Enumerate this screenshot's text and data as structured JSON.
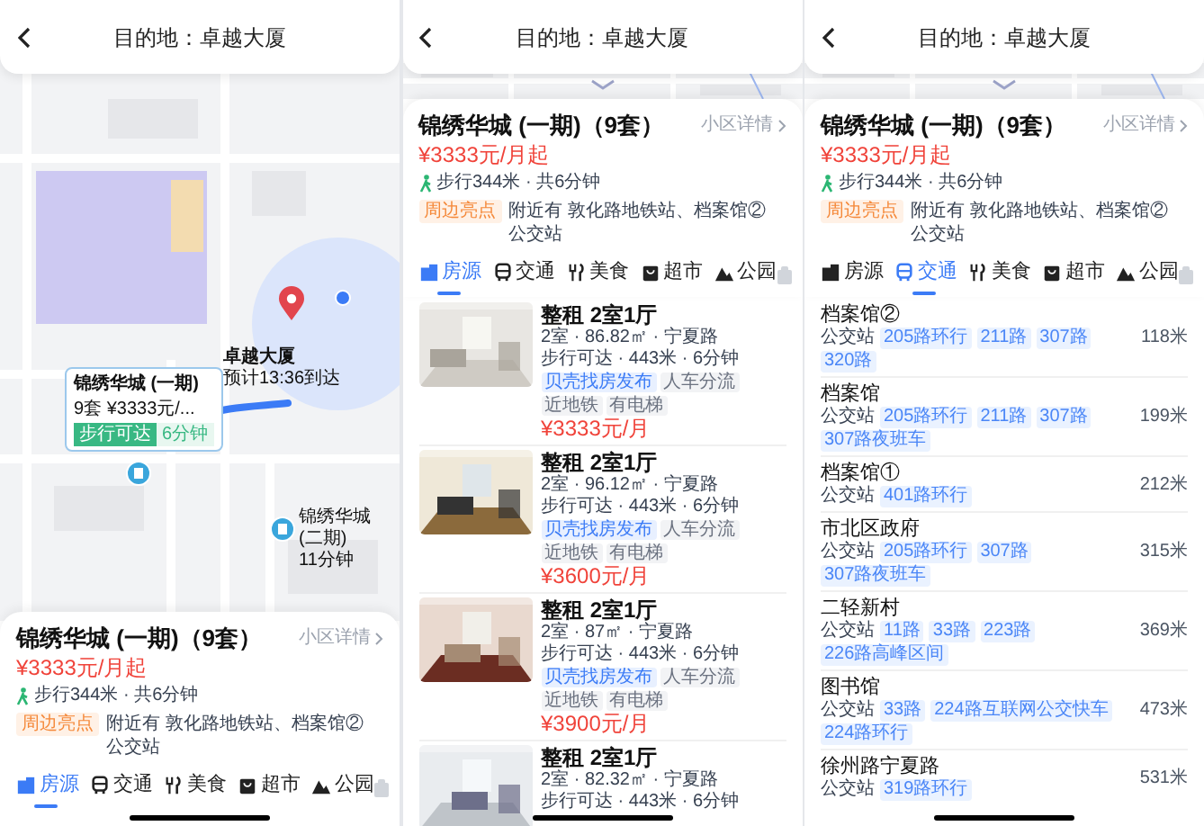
{
  "screens": [
    {
      "kind": "map",
      "header": {
        "title": "目的地：卓越大厦"
      },
      "map": {
        "destination": {
          "name": "卓越大厦",
          "eta": "预计13:36到达"
        },
        "callout": {
          "name": "锦绣华城 (一期)",
          "summary": "9套 ¥3333元/...",
          "tag": "步行可达",
          "time": "6分钟"
        },
        "nearby": {
          "name": "锦绣华城 (二期)",
          "time": "11分钟"
        }
      },
      "sheet": {
        "title": "锦绣华城 (一期)（9套）",
        "detail_link": "小区详情",
        "price": "¥3333元/月起",
        "walk": "步行344米 · 共6分钟",
        "highlight_tag": "周边亮点",
        "highlight": "附近有 敦化路地铁站、档案馆② 公交站",
        "tabs": [
          {
            "label": "房源",
            "selected": true
          },
          {
            "label": "交通",
            "selected": false
          },
          {
            "label": "美食",
            "selected": false
          },
          {
            "label": "超市",
            "selected": false
          },
          {
            "label": "公园",
            "selected": false
          }
        ]
      }
    },
    {
      "kind": "listings",
      "header": {
        "title": "目的地：卓越大厦"
      },
      "sheet": {
        "title": "锦绣华城 (一期)（9套）",
        "detail_link": "小区详情",
        "price": "¥3333元/月起",
        "walk": "步行344米 · 共6分钟",
        "highlight_tag": "周边亮点",
        "highlight": "附近有 敦化路地铁站、档案馆② 公交站",
        "tabs": [
          {
            "label": "房源",
            "selected": true
          },
          {
            "label": "交通",
            "selected": false
          },
          {
            "label": "美食",
            "selected": false
          },
          {
            "label": "超市",
            "selected": false
          },
          {
            "label": "公园",
            "selected": false
          }
        ]
      },
      "listings": [
        {
          "title": "整租 2室1厅",
          "details": "2室 · 86.82㎡ · 宁夏路",
          "walk": "步行可达 · 443米 · 6分钟",
          "tags": [
            {
              "label": "贝壳找房发布",
              "kind": "source"
            },
            {
              "label": "人车分流",
              "kind": "feature"
            },
            {
              "label": "近地铁",
              "kind": "feature"
            },
            {
              "label": "有电梯",
              "kind": "feature"
            }
          ],
          "price": "¥3333元/月"
        },
        {
          "title": "整租 2室1厅",
          "details": "2室 · 96.12㎡ · 宁夏路",
          "walk": "步行可达 · 443米 · 6分钟",
          "tags": [
            {
              "label": "贝壳找房发布",
              "kind": "source"
            },
            {
              "label": "人车分流",
              "kind": "feature"
            },
            {
              "label": "近地铁",
              "kind": "feature"
            },
            {
              "label": "有电梯",
              "kind": "feature"
            }
          ],
          "price": "¥3600元/月"
        },
        {
          "title": "整租 2室1厅",
          "details": "2室 · 87㎡ · 宁夏路",
          "walk": "步行可达 · 443米 · 6分钟",
          "tags": [
            {
              "label": "贝壳找房发布",
              "kind": "source"
            },
            {
              "label": "人车分流",
              "kind": "feature"
            },
            {
              "label": "近地铁",
              "kind": "feature"
            },
            {
              "label": "有电梯",
              "kind": "feature"
            }
          ],
          "price": "¥3900元/月"
        },
        {
          "title": "整租 2室1厅",
          "details": "2室 · 82.32㎡ · 宁夏路",
          "walk": "步行可达 · 443米 · 6分钟"
        }
      ]
    },
    {
      "kind": "transit",
      "header": {
        "title": "目的地：卓越大厦"
      },
      "sheet": {
        "title": "锦绣华城 (一期)（9套）",
        "detail_link": "小区详情",
        "price": "¥3333元/月起",
        "walk": "步行344米 · 共6分钟",
        "highlight_tag": "周边亮点",
        "highlight": "附近有 敦化路地铁站、档案馆② 公交站",
        "tabs": [
          {
            "label": "房源",
            "selected": false
          },
          {
            "label": "交通",
            "selected": true
          },
          {
            "label": "美食",
            "selected": false
          },
          {
            "label": "超市",
            "selected": false
          },
          {
            "label": "公园",
            "selected": false
          }
        ]
      },
      "stations": [
        {
          "name": "档案馆②",
          "type": "公交站",
          "routes": [
            "205路环行",
            "211路",
            "307路",
            "320路"
          ],
          "distance": "118米"
        },
        {
          "name": "档案馆",
          "type": "公交站",
          "routes": [
            "205路环行",
            "211路",
            "307路",
            "307路夜班车"
          ],
          "distance": "199米"
        },
        {
          "name": "档案馆①",
          "type": "公交站",
          "routes": [
            "401路环行"
          ],
          "distance": "212米"
        },
        {
          "name": "市北区政府",
          "type": "公交站",
          "routes": [
            "205路环行",
            "307路",
            "307路夜班车"
          ],
          "distance": "315米"
        },
        {
          "name": "二轻新村",
          "type": "公交站",
          "routes": [
            "11路",
            "33路",
            "223路",
            "226路高峰区间"
          ],
          "distance": "369米"
        },
        {
          "name": "图书馆",
          "type": "公交站",
          "routes": [
            "33路",
            "224路互联网公交快车",
            "224路环行"
          ],
          "distance": "473米"
        },
        {
          "name": "徐州路宁夏路",
          "type": "公交站",
          "routes": [
            "319路环行"
          ],
          "distance": "531米"
        }
      ]
    }
  ]
}
